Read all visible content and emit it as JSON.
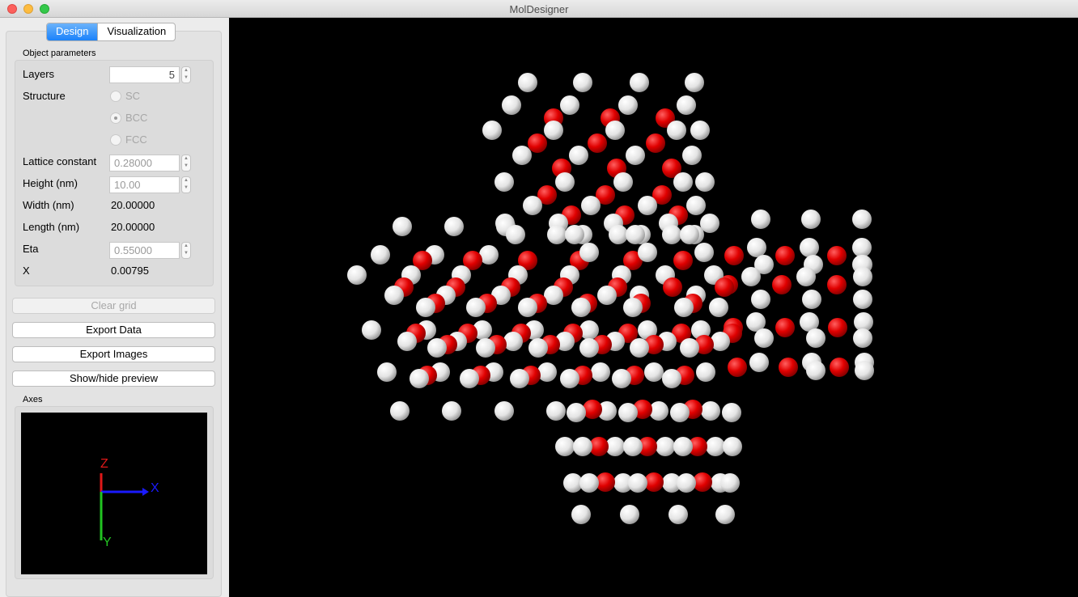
{
  "window": {
    "title": "MolDesigner"
  },
  "tabs": [
    {
      "label": "Design",
      "active": true
    },
    {
      "label": "Visualization",
      "active": false
    }
  ],
  "object_params": {
    "group_label": "Object parameters",
    "layers": {
      "label": "Layers",
      "value": "5"
    },
    "structure": {
      "label": "Structure",
      "options": [
        "SC",
        "BCC",
        "FCC"
      ],
      "selected": "BCC"
    },
    "lattice_constant": {
      "label": "Lattice constant",
      "value": "0.28000"
    },
    "height": {
      "label": "Height (nm)",
      "value": "10.00"
    },
    "width": {
      "label": "Width (nm)",
      "value": "20.00000"
    },
    "length": {
      "label": "Length (nm)",
      "value": "20.00000"
    },
    "eta": {
      "label": "Eta",
      "value": "0.55000"
    },
    "x": {
      "label": "X",
      "value": "0.00795"
    }
  },
  "buttons": {
    "clear_grid": "Clear grid",
    "export_data": "Export Data",
    "export_images": "Export Images",
    "show_hide_preview": "Show/hide preview"
  },
  "axes": {
    "group_label": "Axes",
    "x_label": "X",
    "y_label": "Y",
    "z_label": "Z",
    "x_color": "#1a1aff",
    "y_color": "#22c422",
    "z_color": "#e01818"
  },
  "colors": {
    "accent": "#1a82fb",
    "atom_white": "#f2f2f2",
    "atom_red": "#e40000",
    "viewport_bg": "#000000"
  }
}
